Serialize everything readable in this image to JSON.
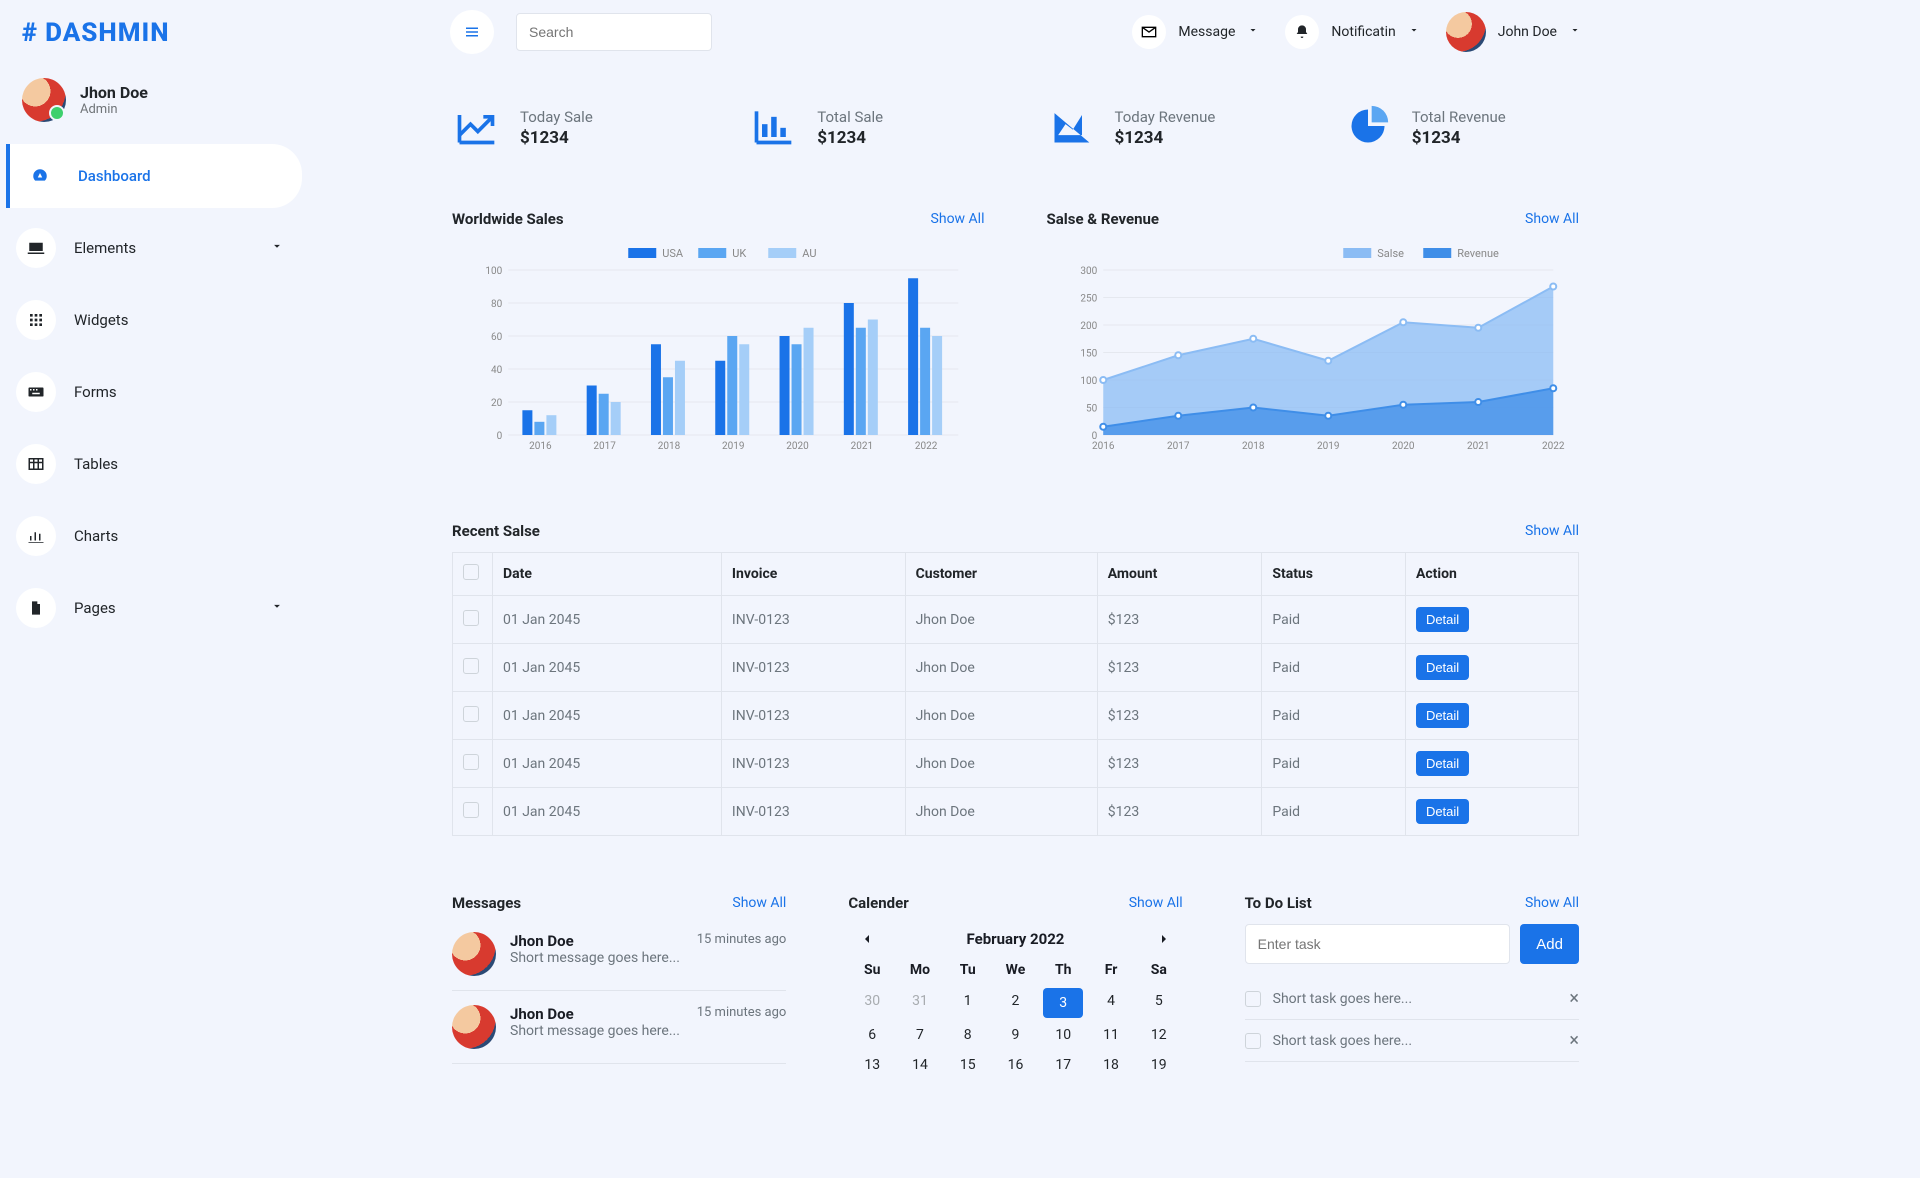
{
  "brand": {
    "name": "DASHMIN"
  },
  "user": {
    "name": "Jhon Doe",
    "role": "Admin"
  },
  "nav": {
    "items": [
      {
        "label": "Dashboard",
        "active": true
      },
      {
        "label": "Elements",
        "expandable": true
      },
      {
        "label": "Widgets"
      },
      {
        "label": "Forms"
      },
      {
        "label": "Tables"
      },
      {
        "label": "Charts"
      },
      {
        "label": "Pages",
        "expandable": true
      }
    ]
  },
  "topbar": {
    "search_placeholder": "Search",
    "message_label": "Message",
    "notification_label": "Notificatin",
    "username": "John Doe"
  },
  "stats": [
    {
      "label": "Today Sale",
      "value": "$1234"
    },
    {
      "label": "Total Sale",
      "value": "$1234"
    },
    {
      "label": "Today Revenue",
      "value": "$1234"
    },
    {
      "label": "Total Revenue",
      "value": "$1234"
    }
  ],
  "worldwide": {
    "title": "Worldwide Sales",
    "show_all": "Show All"
  },
  "salesrev": {
    "title": "Salse & Revenue",
    "show_all": "Show All"
  },
  "recent": {
    "title": "Recent Salse",
    "show_all": "Show All",
    "headers": {
      "date": "Date",
      "invoice": "Invoice",
      "customer": "Customer",
      "amount": "Amount",
      "status": "Status",
      "action": "Action"
    },
    "detail_label": "Detail",
    "rows": [
      {
        "date": "01 Jan 2045",
        "invoice": "INV-0123",
        "customer": "Jhon Doe",
        "amount": "$123",
        "status": "Paid"
      },
      {
        "date": "01 Jan 2045",
        "invoice": "INV-0123",
        "customer": "Jhon Doe",
        "amount": "$123",
        "status": "Paid"
      },
      {
        "date": "01 Jan 2045",
        "invoice": "INV-0123",
        "customer": "Jhon Doe",
        "amount": "$123",
        "status": "Paid"
      },
      {
        "date": "01 Jan 2045",
        "invoice": "INV-0123",
        "customer": "Jhon Doe",
        "amount": "$123",
        "status": "Paid"
      },
      {
        "date": "01 Jan 2045",
        "invoice": "INV-0123",
        "customer": "Jhon Doe",
        "amount": "$123",
        "status": "Paid"
      }
    ]
  },
  "messages": {
    "title": "Messages",
    "show_all": "Show All",
    "items": [
      {
        "name": "Jhon Doe",
        "time": "15 minutes ago",
        "text": "Short message goes here..."
      },
      {
        "name": "Jhon Doe",
        "time": "15 minutes ago",
        "text": "Short message goes here..."
      }
    ]
  },
  "calendar": {
    "title": "Calender",
    "show_all": "Show All",
    "month": "February 2022",
    "dow": [
      "Su",
      "Mo",
      "Tu",
      "We",
      "Th",
      "Fr",
      "Sa"
    ],
    "leading": [
      30,
      31
    ],
    "days": [
      1,
      2,
      3,
      4,
      5,
      6,
      7,
      8,
      9,
      10,
      11,
      12,
      13,
      14,
      15,
      16,
      17,
      18,
      19
    ],
    "selected": 3
  },
  "todo": {
    "title": "To Do List",
    "show_all": "Show All",
    "placeholder": "Enter task",
    "add_label": "Add",
    "items": [
      {
        "text": "Short task goes here..."
      },
      {
        "text": "Short task goes here..."
      }
    ]
  },
  "chart_data": [
    {
      "type": "bar",
      "title": "Worldwide Sales",
      "categories": [
        "2016",
        "2017",
        "2018",
        "2019",
        "2020",
        "2021",
        "2022"
      ],
      "series": [
        {
          "name": "USA",
          "values": [
            15,
            30,
            55,
            45,
            60,
            80,
            95
          ]
        },
        {
          "name": "UK",
          "values": [
            8,
            25,
            35,
            60,
            55,
            65,
            65
          ]
        },
        {
          "name": "AU",
          "values": [
            12,
            20,
            45,
            55,
            65,
            70,
            60
          ]
        }
      ],
      "ylim": [
        0,
        100
      ],
      "yticks": [
        0,
        20,
        40,
        60,
        80,
        100
      ],
      "colors": {
        "USA": "#1a73e8",
        "UK": "#5aa6f2",
        "AU": "#a5cef8"
      }
    },
    {
      "type": "area",
      "title": "Salse & Revenue",
      "categories": [
        "2016",
        "2017",
        "2018",
        "2019",
        "2020",
        "2021",
        "2022"
      ],
      "series": [
        {
          "name": "Salse",
          "values": [
            100,
            145,
            175,
            135,
            205,
            195,
            270
          ]
        },
        {
          "name": "Revenue",
          "values": [
            15,
            35,
            50,
            35,
            55,
            60,
            85
          ]
        }
      ],
      "ylim": [
        0,
        300
      ],
      "yticks": [
        0,
        50,
        100,
        150,
        200,
        250,
        300
      ],
      "colors": {
        "Salse": "#8bbcf4",
        "Revenue": "#3f8ee8"
      }
    }
  ]
}
